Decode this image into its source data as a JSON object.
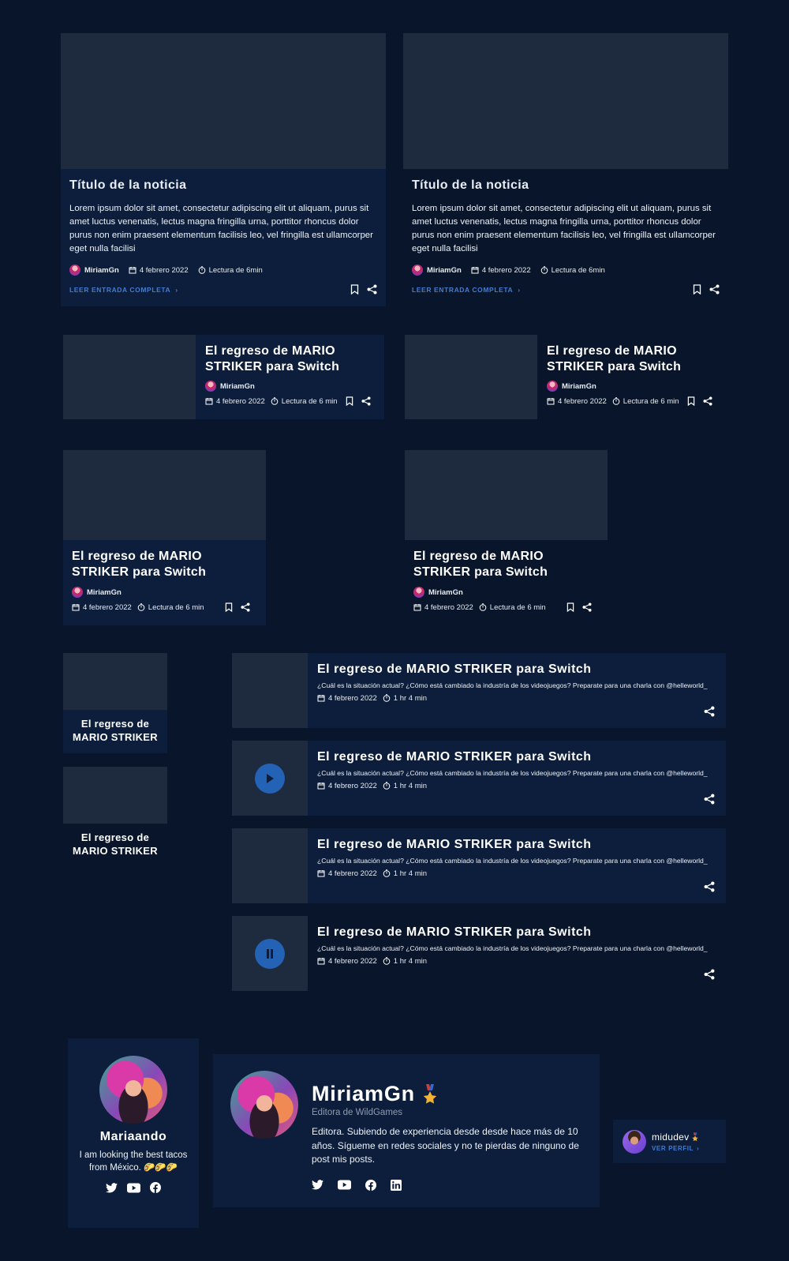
{
  "icons": {
    "bookmark": "bookmark-icon",
    "share": "share-icon",
    "calendar": "calendar-icon",
    "timer": "timer-icon",
    "chevron": "chevron-right-icon",
    "play": "play-icon",
    "pause": "pause-icon",
    "twitter": "twitter-icon",
    "youtube": "youtube-icon",
    "facebook": "facebook-icon",
    "linkedin": "linkedin-icon",
    "medal": "medal-icon"
  },
  "colors": {
    "background": "#08152a",
    "card": "#0c1e3b",
    "placeholder": "#1e2b3f",
    "accent": "#2462b5",
    "link": "#3f7dd8"
  },
  "large_cards": [
    {
      "title": "Título de la noticia",
      "body": "Lorem ipsum dolor sit amet, consectetur adipiscing elit ut aliquam, purus sit amet luctus venenatis, lectus magna fringilla urna, porttitor rhoncus dolor purus non enim praesent elementum facilisis leo, vel fringilla est ullamcorper eget nulla facilisi",
      "author": "MiriamGn",
      "date": "4 febrero 2022",
      "read_time": "Lectura de 6min",
      "link": "LEER ENTRADA COMPLETA"
    },
    {
      "title": "Título de la noticia",
      "body": "Lorem ipsum dolor sit amet, consectetur adipiscing elit ut aliquam, purus sit amet luctus venenatis, lectus magna fringilla urna, porttitor rhoncus dolor purus non enim praesent elementum facilisis leo, vel fringilla est ullamcorper eget nulla facilisi",
      "author": "MiriamGn",
      "date": "4 febrero 2022",
      "read_time": "Lectura de 6min",
      "link": "LEER ENTRADA COMPLETA"
    }
  ],
  "horizontal_cards": [
    {
      "title": "El regreso de MARIO STRIKER para Switch",
      "author": "MiriamGn",
      "date": "4 febrero 2022",
      "read_time": "Lectura de 6 min"
    },
    {
      "title": "El regreso de MARIO STRIKER para Switch",
      "author": "MiriamGn",
      "date": "4 febrero 2022",
      "read_time": "Lectura de 6 min"
    }
  ],
  "vertical_cards": [
    {
      "title": "El regreso de MARIO STRIKER para Switch",
      "author": "MiriamGn",
      "date": "4 febrero 2022",
      "read_time": "Lectura de 6 min"
    },
    {
      "title": "El regreso de MARIO STRIKER para Switch",
      "author": "MiriamGn",
      "date": "4 febrero 2022",
      "read_time": "Lectura de 6 min"
    }
  ],
  "small_cards": [
    {
      "title": "El regreso de MARIO STRIKER"
    },
    {
      "title": "El regreso de MARIO STRIKER"
    }
  ],
  "podcast_rows": [
    {
      "title": "El regreso de MARIO STRIKER para Switch",
      "desc": "¿Cuál es la situación actual? ¿Cómo está cambiado la industría de los videojuegos? Preparate para una charla con @helleworld_",
      "date": "4 febrero 2022",
      "duration": "1 hr 4 min",
      "media": "none"
    },
    {
      "title": "El regreso de MARIO STRIKER para Switch",
      "desc": "¿Cuál es la situación actual? ¿Cómo está cambiado la industría de los videojuegos? Preparate para una charla con @helleworld_",
      "date": "4 febrero 2022",
      "duration": "1 hr 4 min",
      "media": "play"
    },
    {
      "title": "El regreso de MARIO STRIKER para Switch",
      "desc": "¿Cuál es la situación actual? ¿Cómo está cambiado la industría de los videojuegos? Preparate para una charla con @helleworld_",
      "date": "4 febrero 2022",
      "duration": "1 hr 4 min",
      "media": "none"
    },
    {
      "title": "El regreso de MARIO STRIKER para Switch",
      "desc": "¿Cuál es la situación actual? ¿Cómo está cambiado la industría de los videojuegos? Preparate para una charla con @helleworld_",
      "date": "4 febrero 2022",
      "duration": "1 hr 4 min",
      "media": "pause"
    }
  ],
  "profile_small": {
    "name": "Mariaando",
    "bio": "I am looking the best tacos from México. 🌮🌮🌮"
  },
  "profile_large": {
    "name": "MiriamGn",
    "role": "Editora de WildGames",
    "bio": "Editora. Subiendo de experiencia desde desde hace más de 10 años. Sígueme en redes sociales y no te pierdas de ninguno de post mis posts."
  },
  "profile_mini": {
    "name": "midudev",
    "link": "VER PERFIL"
  }
}
